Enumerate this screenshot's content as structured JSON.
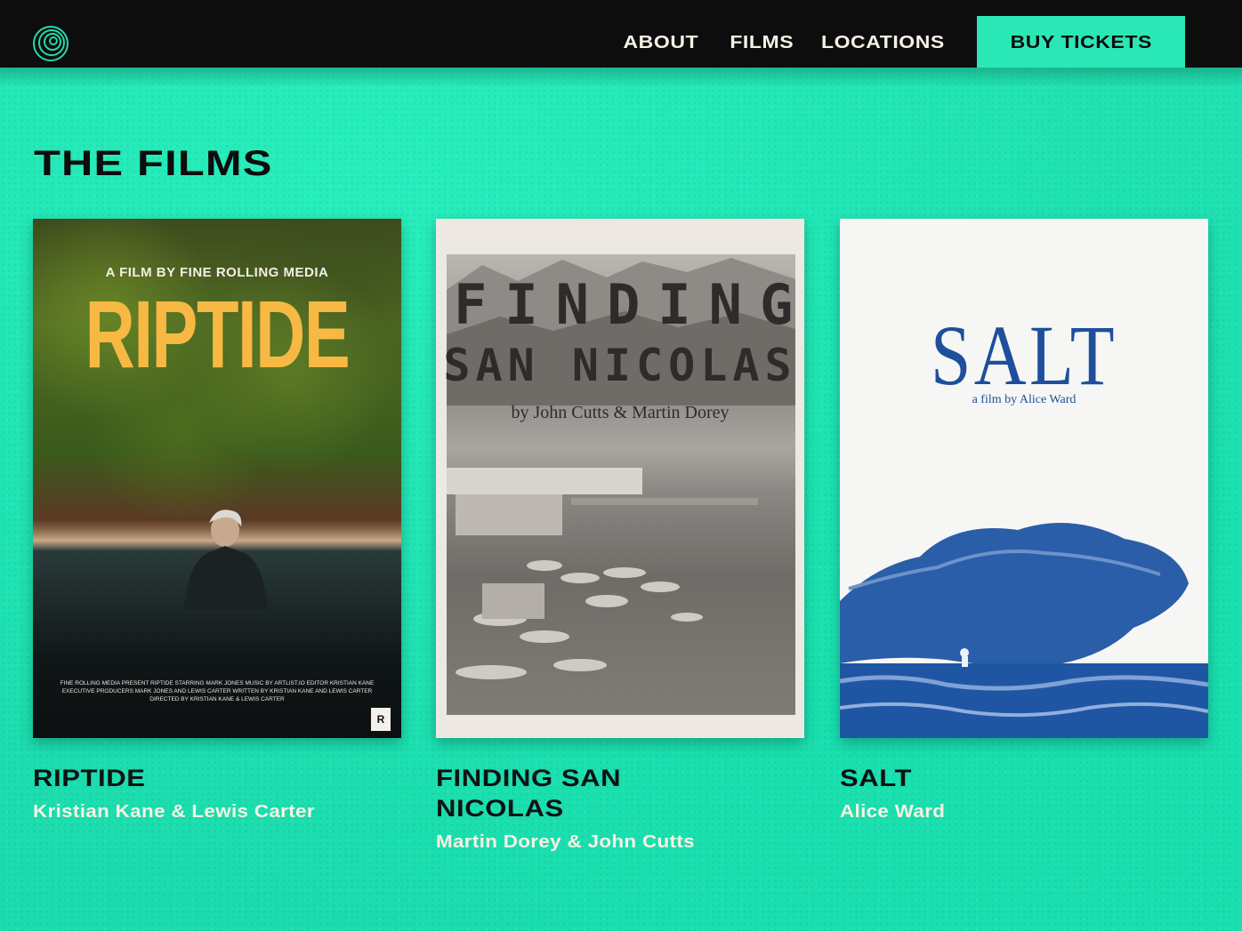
{
  "header": {
    "nav": [
      "ABOUT",
      "FILMS",
      "LOCATIONS"
    ],
    "cta": "BUY TICKETS"
  },
  "section_title": "THE FILMS",
  "films": [
    {
      "title": "RIPTIDE",
      "makers": "Kristian Kane & Lewis Carter",
      "poster": {
        "pre": "A FILM BY FINE ROLLING MEDIA",
        "title": "RIPTIDE",
        "credits": "FINE ROLLING MEDIA PRESENT RIPTIDE STARRING MARK JONES MUSIC BY ARTLIST.IO EDITOR KRISTIAN KANE EXECUTIVE PRODUCERS MARK JONES AND LEWIS CARTER WRITTEN BY KRISTIAN KANE AND LEWIS CARTER DIRECTED BY KRISTIAN KANE & LEWIS CARTER",
        "badge": "R"
      }
    },
    {
      "title": "FINDING SAN NICOLAS",
      "makers": "Martin Dorey & John Cutts",
      "poster": {
        "title_line1": "FINDING",
        "title_line2": "SAN NICOLAS",
        "by": "by John Cutts & Martin Dorey"
      }
    },
    {
      "title": "SALT",
      "makers": "Alice Ward",
      "poster": {
        "title": "SALT",
        "by": "a film by Alice Ward"
      }
    }
  ],
  "colors": {
    "background": "#1ee6b0",
    "header": "#0d0d0e",
    "cta": "#2ae8b6",
    "riptide_title": "#f7b944",
    "salt_blue": "#1e4f9c"
  }
}
